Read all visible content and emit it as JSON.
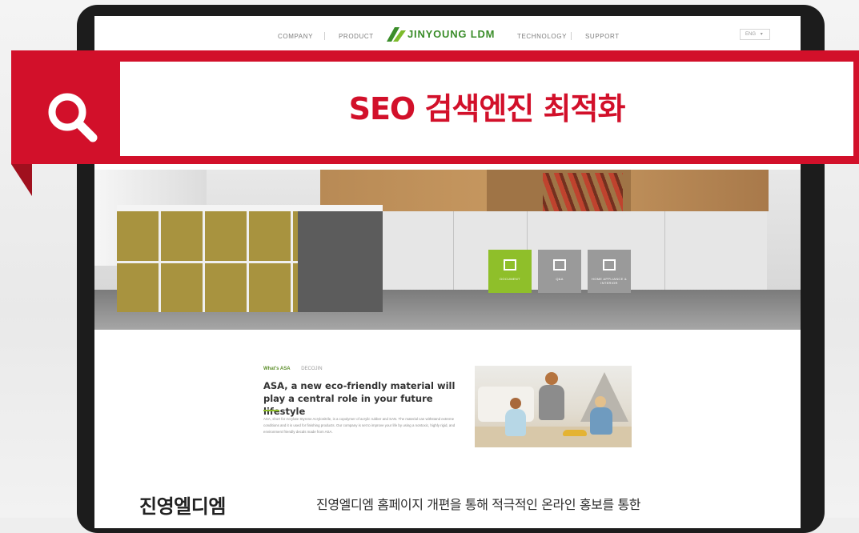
{
  "site": {
    "nav": {
      "company": "COMPANY",
      "product": "PRODUCT",
      "technology": "TECHNOLOGY",
      "support": "SUPPORT"
    },
    "logo_text": "JINYOUNG LDM",
    "lang_select": "ENG"
  },
  "banner": {
    "title": "SEO 검색엔진 최적화",
    "icon": "search-icon",
    "color": "#d2102a"
  },
  "hero": {
    "buttons": [
      {
        "label": "DOCUMENT",
        "color": "#8fbf2a"
      },
      {
        "label": "Q&A",
        "color": "#9a9a9a"
      },
      {
        "label": "HOME APPLIANCE & INTERIOR",
        "color": "#9a9a9a"
      }
    ]
  },
  "asa": {
    "tabs": [
      "What's ASA",
      "DECOJIN"
    ],
    "heading": "ASA, a new eco-friendly material will play a central role in your future lifestyle",
    "body": "ASA, short for Acrylate Styrene Acrylonitrile, is a copolymer of acrylic rubber and SAN. The material can withstand extreme conditions and it is used for finishing products. Our company is set to improve your life by using a nontoxic, highly rigid, and environment friendly decals made from ASA."
  },
  "footer": {
    "brand": "진영엘디엠",
    "desc": "진영엘디엠 홈페이지 개편을 통해 적극적인 온라인 홍보를 통한"
  }
}
